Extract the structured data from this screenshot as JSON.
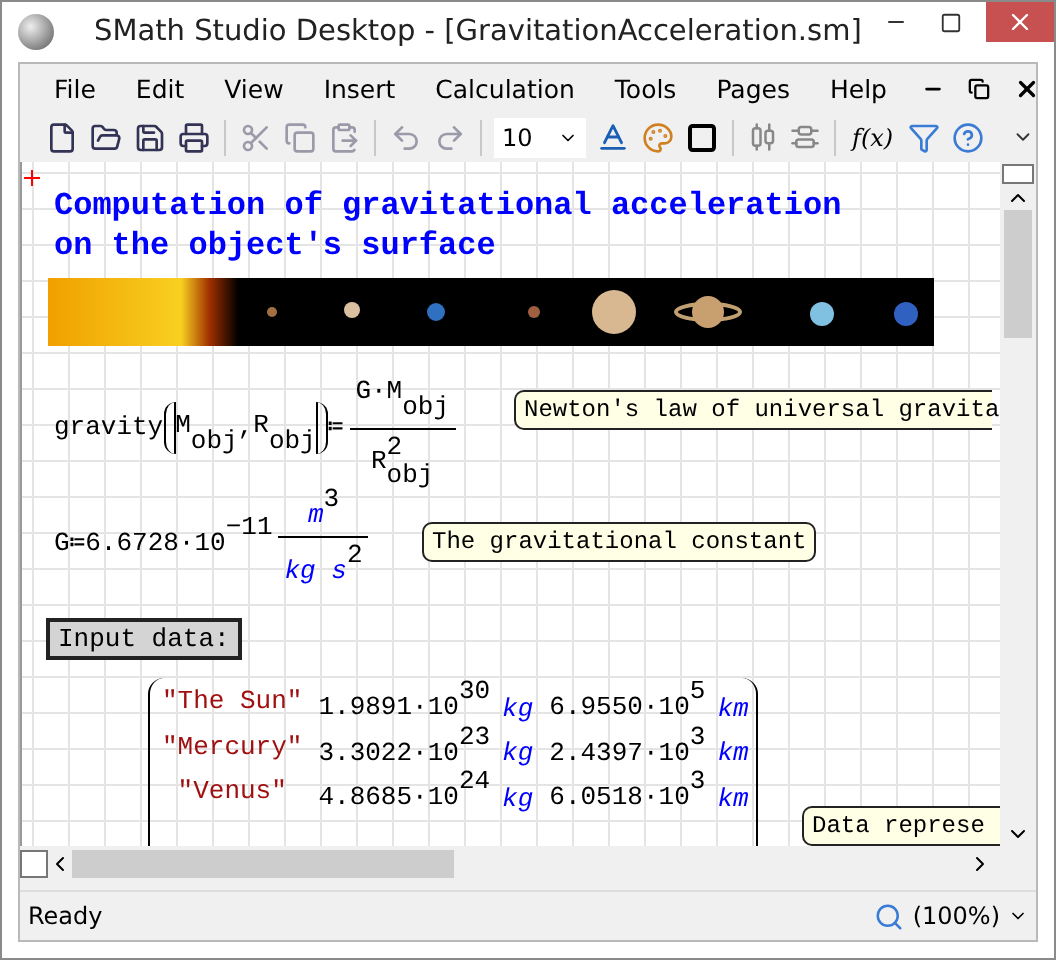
{
  "window": {
    "title": "SMath Studio Desktop - [GravitationAcceleration.sm]"
  },
  "menu": [
    "File",
    "Edit",
    "View",
    "Insert",
    "Calculation",
    "Tools",
    "Pages",
    "Help"
  ],
  "toolbar": {
    "font_size": "10",
    "function_button": "f(x)"
  },
  "worksheet": {
    "heading": [
      "Computation of gravitational acceleration",
      "on the object's surface"
    ],
    "gravity_def": {
      "name": "gravity",
      "separator": ",",
      "args": [
        {
          "base": "M",
          "sub": "obj"
        },
        {
          "base": "R",
          "sub": "obj"
        }
      ],
      "op": "≔",
      "numerator": {
        "base": "G·M",
        "sub": "obj"
      },
      "denominator": {
        "base": "R",
        "sub": "obj",
        "sup": "2"
      },
      "note": "Newton's law of universal gravita"
    },
    "g_def": {
      "name": "G",
      "op": "≔",
      "mantissa": "6.6728·10",
      "exponent": "−11",
      "unit_num": "m",
      "unit_num_sup": "3",
      "unit_den": "kg s",
      "unit_den_sup": "2",
      "note": "The gravitational constant"
    },
    "input_label": "Input data:",
    "matrix": [
      {
        "name": "\"The Sun\"",
        "mass": "1.9891·10",
        "mass_exp": "30",
        "mass_unit": "kg",
        "radius": "6.9550·10",
        "radius_exp": "5",
        "radius_unit": "km"
      },
      {
        "name": "\"Mercury\"",
        "mass": "3.3022·10",
        "mass_exp": "23",
        "mass_unit": "kg",
        "radius": "2.4397·10",
        "radius_exp": "3",
        "radius_unit": "km"
      },
      {
        "name": "\"Venus\"",
        "mass": "4.8685·10",
        "mass_exp": "24",
        "mass_unit": "kg",
        "radius": "6.0518·10",
        "radius_exp": "3",
        "radius_unit": "km"
      }
    ],
    "side_note": "Data represe"
  },
  "status": {
    "text": "Ready",
    "zoom": "(100%)"
  }
}
